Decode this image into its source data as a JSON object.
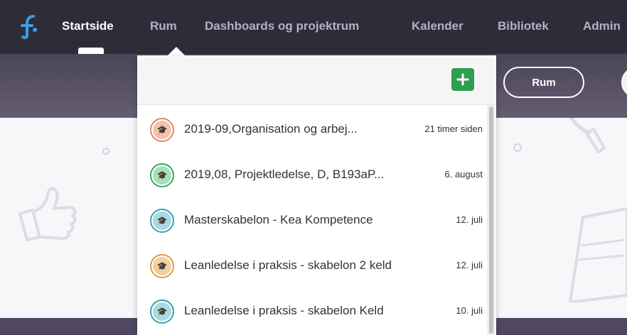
{
  "nav": {
    "items": [
      {
        "label": "Startside",
        "active": true
      },
      {
        "label": "Rum",
        "active": false
      },
      {
        "label": "Dashboards og projektrum",
        "active": false
      },
      {
        "label": "Kalender",
        "active": false
      },
      {
        "label": "Bibliotek",
        "active": false
      },
      {
        "label": "Admin",
        "active": false
      }
    ]
  },
  "subheader": {
    "rum_button_label": "Rum"
  },
  "dropdown": {
    "add_icon": "plus-icon",
    "rooms": [
      {
        "title": "2019-09,Organisation og arbej...",
        "time": "21 timer siden",
        "color": "#e0876a",
        "fill": "#f3c2ad"
      },
      {
        "title": "2019,08, Projektledelse, D, B193aP...",
        "time": "6. august",
        "color": "#3aa564",
        "fill": "#a7dfb9"
      },
      {
        "title": "Masterskabelon - Kea Kompetence",
        "time": "12. juli",
        "color": "#3a9fae",
        "fill": "#a6dbe3"
      },
      {
        "title": "Leanledelse i praksis - skabelon 2 keld",
        "time": "12. juli",
        "color": "#d99a4a",
        "fill": "#f2d09d"
      },
      {
        "title": "Leanledelse i praksis - skabelon Keld",
        "time": "10. juli",
        "color": "#3a9fae",
        "fill": "#a6dbe3"
      }
    ]
  },
  "colors": {
    "nav_bg": "#2f2c3a",
    "accent_green": "#2e9e4f",
    "logo_blue": "#3aa0e0"
  }
}
